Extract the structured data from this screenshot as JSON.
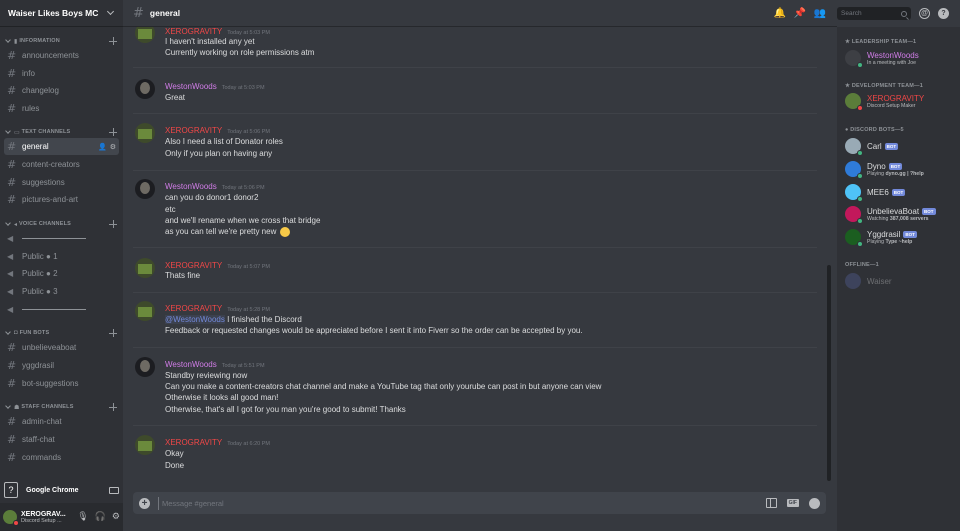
{
  "server": {
    "name": "Waiser Likes Boys MC"
  },
  "categories": {
    "information": {
      "label": "INFORMATION",
      "emoji": "▮"
    },
    "text": {
      "label": "TEXT CHANNELS",
      "emoji": "▭"
    },
    "voice": {
      "label": "VOICE CHANNELS",
      "emoji": "◂"
    },
    "funbots": {
      "label": "FUN BOTS",
      "emoji": "◘"
    },
    "staff": {
      "label": "STAFF CHANNELS",
      "emoji": "☗"
    }
  },
  "channels": {
    "information": [
      "announcements",
      "info",
      "changelog",
      "rules"
    ],
    "text": [
      "general",
      "content-creators",
      "suggestions",
      "pictures-and-art"
    ],
    "voice": [
      "Public ● 1",
      "Public ● 2",
      "Public ● 3"
    ],
    "funbots": [
      "unbelieveaboat",
      "yggdrasil",
      "bot-suggestions"
    ],
    "staff": [
      "admin-chat",
      "staff-chat",
      "commands"
    ]
  },
  "help_bar": {
    "label": "Google Chrome",
    "icon": "?"
  },
  "user": {
    "name": "XEROGRAV...",
    "status": "Discord Setup ..."
  },
  "header": {
    "channel": "general",
    "search_placeholder": "Search"
  },
  "messages": [
    {
      "author": "XEROGRAVITY",
      "timestamp": "Today at 5:03 PM",
      "lines": [
        "I haven't installed any yet",
        "Currently working on role permissions atm"
      ]
    },
    {
      "author": "WestonWoods",
      "timestamp": "Today at 5:03 PM",
      "lines": [
        "Great"
      ]
    },
    {
      "author": "XEROGRAVITY",
      "timestamp": "Today at 5:06 PM",
      "lines": [
        "Also I need a list of Donator roles",
        "Only if you plan on having any"
      ]
    },
    {
      "author": "WestonWoods",
      "timestamp": "Today at 5:06 PM",
      "lines": [
        "can you do donor1 donor2",
        "etc",
        "and we'll rename when we cross that bridge",
        "as you can tell we're pretty new"
      ]
    },
    {
      "author": "XEROGRAVITY",
      "timestamp": "Today at 5:07 PM",
      "lines": [
        "Thats fine"
      ]
    },
    {
      "author": "XEROGRAVITY",
      "timestamp": "Today at 5:28 PM",
      "mention": "@WestonWoods",
      "lines": [
        " I finished the Discord",
        "Feedback or requested changes would be appreciated before I sent it into Fiverr so the order can be accepted by you."
      ]
    },
    {
      "author": "WestonWoods",
      "timestamp": "Today at 5:51 PM",
      "lines": [
        "Standby reviewing now",
        "Can you make a content-creators chat channel and make a YouTube tag that only yourube can post in but anyone can view",
        "Otherwise it looks all good man!",
        "Otherwise, that's all I got for you man you're good to submit! Thanks"
      ]
    },
    {
      "author": "XEROGRAVITY",
      "timestamp": "Today at 6:20 PM",
      "lines": [
        "Okay",
        "Done"
      ]
    }
  ],
  "composer": {
    "placeholder": "Message #general",
    "gif_label": "GIF",
    "add_label": "+"
  },
  "member_list": {
    "leadership": {
      "label": "★ LEADERSHIP TEAM—1",
      "members": [
        {
          "name": "WestonWoods",
          "sub": "In a meeting with Joe",
          "color": "#d17de8",
          "status": "#43b581"
        }
      ]
    },
    "development": {
      "label": "★ DEVELOPMENT TEAM—1",
      "members": [
        {
          "name": "XEROGRAVITY",
          "sub": "Discord Setup Maker",
          "color": "#f04747",
          "status": "#f04747"
        }
      ]
    },
    "bots": {
      "label": "● DISCORD BOTS—5",
      "bot_tag": "BOT",
      "members": [
        {
          "name": "Carl",
          "sub": "",
          "color": "#dcddde",
          "status": "#43b581"
        },
        {
          "name": "Dyno",
          "sub_prefix": "Playing ",
          "sub_bold": "dyno.gg | ?help",
          "color": "#dcddde",
          "status": "#43b581"
        },
        {
          "name": "MEE6",
          "sub": "",
          "color": "#dcddde",
          "status": "#43b581"
        },
        {
          "name": "UnbelievaBoat",
          "sub_prefix": "Watching ",
          "sub_bold": "387,008 servers",
          "color": "#dcddde",
          "status": "#43b581"
        },
        {
          "name": "Yggdrasil",
          "sub_prefix": "Playing ",
          "sub_bold": "Type ~help",
          "color": "#dcddde",
          "status": "#43b581"
        }
      ]
    },
    "offline": {
      "label": "OFFLINE—1",
      "members": [
        {
          "name": "Waiser",
          "sub": "",
          "color": "#8e9297"
        }
      ]
    }
  },
  "colors": {
    "xero": "#f04747",
    "weston": "#d17de8",
    "online": "#43b581",
    "dnd": "#f04747",
    "blurple": "#7289da"
  }
}
